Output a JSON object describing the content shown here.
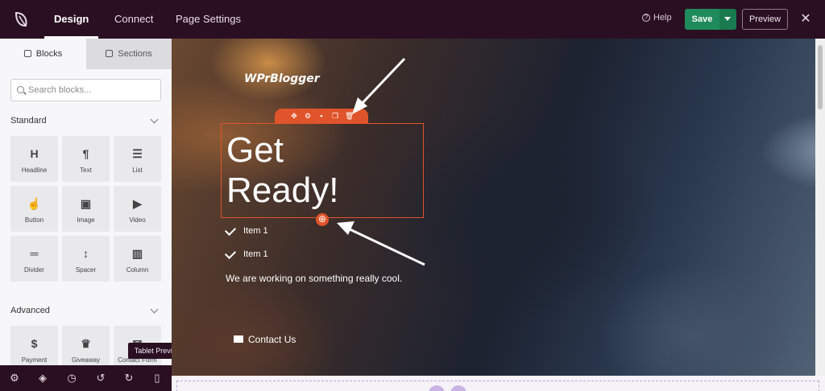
{
  "topbar": {
    "tabs": [
      {
        "label": "Design",
        "active": true
      },
      {
        "label": "Connect",
        "active": false
      },
      {
        "label": "Page Settings",
        "active": false
      }
    ],
    "help_label": "Help",
    "save_label": "Save",
    "preview_label": "Preview",
    "close_icon": "close-icon"
  },
  "sidebar": {
    "tabs": [
      {
        "label": "Blocks",
        "icon": "blocks-icon",
        "active": true
      },
      {
        "label": "Sections",
        "icon": "sections-icon",
        "active": false
      }
    ],
    "search_placeholder": "Search blocks...",
    "groups": [
      {
        "title": "Standard",
        "blocks": [
          {
            "label": "Headline",
            "glyph": "H"
          },
          {
            "label": "Text",
            "glyph": "¶"
          },
          {
            "label": "List",
            "glyph": "☰"
          },
          {
            "label": "Button",
            "glyph": "☝"
          },
          {
            "label": "Image",
            "glyph": "▣"
          },
          {
            "label": "Video",
            "glyph": "▶"
          },
          {
            "label": "Divider",
            "glyph": "═"
          },
          {
            "label": "Spacer",
            "glyph": "↕"
          },
          {
            "label": "Column",
            "glyph": "▥"
          }
        ]
      },
      {
        "title": "Advanced",
        "blocks": [
          {
            "label": "Payment",
            "glyph": "$"
          },
          {
            "label": "Giveaway",
            "glyph": "♛"
          },
          {
            "label": "Contact Form",
            "glyph": "✉"
          }
        ]
      }
    ],
    "tooltip": "Tablet Preview"
  },
  "bottom_toolbar": {
    "icons": [
      "settings-icon",
      "layers-icon",
      "history-icon",
      "undo-icon",
      "redo-icon",
      "tablet-preview-icon"
    ]
  },
  "canvas": {
    "site_logo": "WPrBlogger",
    "heading": "Get Ready!",
    "heading_line1": "Get",
    "heading_line2": "Ready!",
    "list_items": [
      "Item 1",
      "Item 1"
    ],
    "subtext": "We are working on something really cool.",
    "contact_label": "Contact Us",
    "block_toolbar_icons": [
      "move-icon",
      "gear-icon",
      "save-icon",
      "duplicate-icon",
      "trash-icon"
    ],
    "accent_color": "#e0542b"
  },
  "colors": {
    "topbar_bg": "#2a0f22",
    "save_green": "#1f8a5b"
  }
}
